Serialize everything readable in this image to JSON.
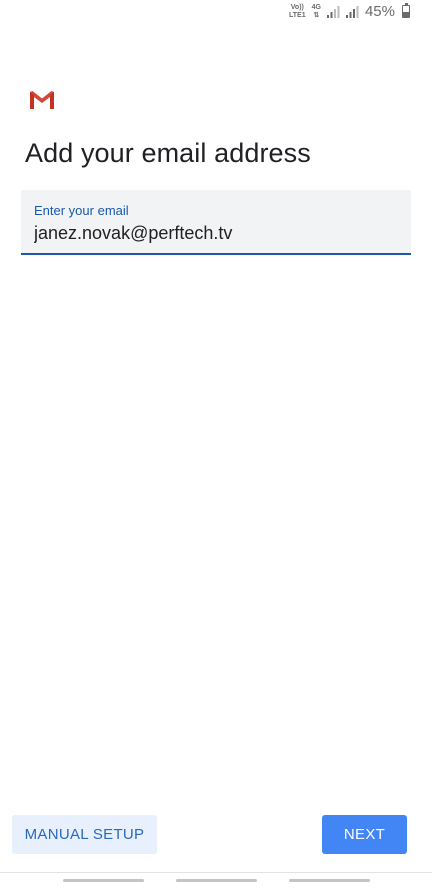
{
  "status_bar": {
    "volte_line1": "Vo))",
    "volte_line2": "LTE1",
    "network": "4G",
    "battery_percent": "45%",
    "battery_level": 0.45
  },
  "app": {
    "logo_icon": "gmail-logo-icon",
    "brand_color": "#d44638"
  },
  "page": {
    "title": "Add your email address"
  },
  "email_field": {
    "label": "Enter your email",
    "value": "janez.novak@perftech.tv",
    "accent_color": "#1a5aa8"
  },
  "actions": {
    "manual_setup_label": "MANUAL SETUP",
    "next_label": "NEXT",
    "next_color": "#4285f4"
  }
}
